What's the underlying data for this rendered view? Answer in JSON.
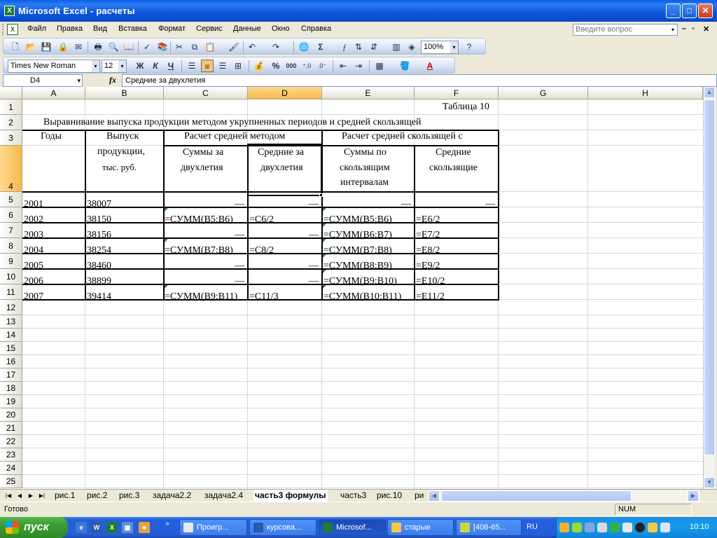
{
  "window": {
    "title": "Microsoft Excel - расчеты",
    "app_icon": "excel-icon",
    "minimize": "_",
    "maximize": "□",
    "close": "✕"
  },
  "menu": {
    "items": [
      "Файл",
      "Правка",
      "Вид",
      "Вставка",
      "Формат",
      "Сервис",
      "Данные",
      "Окно",
      "Справка"
    ],
    "ask_placeholder": "Введите вопрос",
    "ask_dropdown": "▾",
    "doc_minimize": "–",
    "doc_restore": "₽",
    "doc_close": "✕"
  },
  "standard_toolbar": {
    "zoom": "100%"
  },
  "format_toolbar": {
    "font": "Times New Roman",
    "size": "12",
    "bold": "Ж",
    "italic": "К",
    "underline": "Ч",
    "percent": "%",
    "thousands": "000"
  },
  "formula_bar": {
    "name_box": "D4",
    "fx": "fx",
    "content": "Средние за двухлетия"
  },
  "columns": [
    "A",
    "B",
    "C",
    "D",
    "E",
    "F",
    "G",
    "H"
  ],
  "selected_column": "D",
  "rows": [
    "1",
    "2",
    "3",
    "4",
    "5",
    "6",
    "7",
    "8",
    "9",
    "10",
    "11",
    "12",
    "13",
    "14",
    "15",
    "16",
    "17",
    "18",
    "19",
    "20",
    "21",
    "22",
    "23",
    "24",
    "25"
  ],
  "selected_row": "4",
  "sheet": {
    "table_label": "Таблица 10",
    "title": "Выравнивание выпуска продукции методом укрупненных периодов и средней скользящей",
    "header": {
      "years": "Годы",
      "output": [
        "Выпуск",
        "продукции,",
        "тыс. руб."
      ],
      "group1": "Расчет средней методом",
      "group2": "Расчет средней скользящей с",
      "c4": [
        "Суммы за",
        "двухлетия"
      ],
      "d4": [
        "Средние за",
        "двухлетия"
      ],
      "e4": [
        "Суммы по",
        "скользящим",
        "интервалам"
      ],
      "f4": [
        "Средние",
        "скользящие"
      ]
    },
    "data": [
      {
        "year": "2001",
        "out": "38007",
        "c": "—",
        "d": "—",
        "e": "—",
        "f": "—"
      },
      {
        "year": "2002",
        "out": "38150",
        "c": "=СУММ(B5:B6)",
        "d": "=C6/2",
        "e": "=СУММ(B5:B6)",
        "f": "=E6/2"
      },
      {
        "year": "2003",
        "out": "38156",
        "c": "—",
        "d": "—",
        "e": "=СУММ(B6:B7)",
        "f": "=E7/2"
      },
      {
        "year": "2004",
        "out": "38254",
        "c": "=СУММ(B7:B8)",
        "d": "=C8/2",
        "e": "=СУММ(B7:B8)",
        "f": "=E8/2"
      },
      {
        "year": "2005",
        "out": "38460",
        "c": "—",
        "d": "—",
        "e": "=СУММ(B8:B9)",
        "f": "=E9/2"
      },
      {
        "year": "2006",
        "out": "38899",
        "c": "—",
        "d": "—",
        "e": "=СУММ(B9:B10)",
        "f": "=E10/2"
      },
      {
        "year": "2007",
        "out": "39414",
        "c": "=СУММ(B9:B11)",
        "d": "=C11/3",
        "e": "=СУММ(B10:B11)",
        "f": "=E11/2"
      }
    ]
  },
  "tabs": [
    "рис.1",
    "рис.2",
    "рис.3",
    "задача2.2",
    "задача2.4",
    "часть3 формулы",
    "часть3",
    "рис.10",
    "ри"
  ],
  "active_tab": "часть3 формулы",
  "status": {
    "ready": "Готово",
    "num": "NUM"
  },
  "taskbar": {
    "start": "пуск",
    "tasks": [
      "Проигр...",
      "курсова...",
      "Microsof...",
      "старые",
      "[408-65..."
    ],
    "active_task": "Microsof...",
    "lang": "RU",
    "clock": "10:10"
  },
  "colors": {
    "title_blue": "#0A5FE8",
    "selected_header": "#F8B84C",
    "taskbar_blue": "#245EDB",
    "start_green": "#3C9A34"
  }
}
